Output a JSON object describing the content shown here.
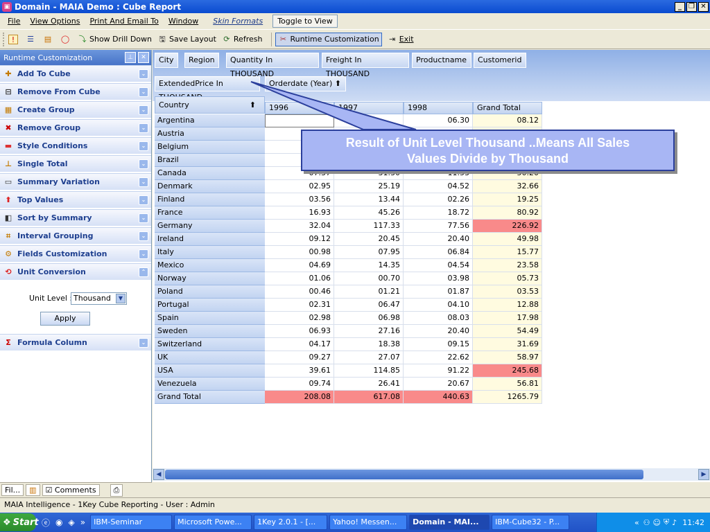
{
  "window": {
    "title": "Domain - MAIA Demo : Cube Report",
    "app_icon": "cube-icon",
    "min_glyph": "_",
    "max_glyph": "❐",
    "close_glyph": "✕"
  },
  "menu": {
    "file": "File",
    "view_options": "View Options",
    "print_email": "Print And Email To",
    "window": "Window",
    "skin_formats": "Skin Formats",
    "toggle_view": "Toggle to View"
  },
  "toolbar": {
    "show_drill_down": "Show Drill Down",
    "save_layout": "Save Layout",
    "refresh": "Refresh",
    "runtime_customization": "Runtime Customization",
    "exit": "Exit"
  },
  "panel": {
    "title": "Runtime Customization",
    "items": [
      "Add To Cube",
      "Remove From Cube",
      "Create Group",
      "Remove Group",
      "Style Conditions",
      "Single Total",
      "Summary Variation",
      "Top Values",
      "Sort by Summary",
      "Interval Grouping",
      "Fields Customization",
      "Unit Conversion"
    ],
    "unit_label": "Unit Level :",
    "unit_value": "Thousand",
    "apply": "Apply",
    "formula_column": "Formula Column",
    "bottom_tabs": [
      "Fil...",
      "Comments"
    ]
  },
  "fields": {
    "chips": [
      "City",
      "Region",
      "Quantity In THOUSAND",
      "Freight In THOUSAND",
      "Productname",
      "Customerid"
    ],
    "data_field": "ExtendedPrice In THOUSAND",
    "column_field": "Orderdate (Year)",
    "row_field": "Country"
  },
  "table": {
    "columns": [
      "1996",
      "1997",
      "1998",
      "Grand Total"
    ],
    "rows": [
      {
        "country": "Argentina",
        "v": [
          "",
          "",
          "06.30",
          "08.12"
        ]
      },
      {
        "country": "Austria",
        "v": [
          "",
          "",
          "",
          ""
        ]
      },
      {
        "country": "Belgium",
        "v": [
          "",
          "",
          "",
          ""
        ]
      },
      {
        "country": "Brazil",
        "v": [
          "",
          "",
          "",
          ""
        ]
      },
      {
        "country": "Canada",
        "v": [
          "07.37",
          "31.30",
          "11.53",
          "50.20"
        ]
      },
      {
        "country": "Denmark",
        "v": [
          "02.95",
          "25.19",
          "04.52",
          "32.66"
        ]
      },
      {
        "country": "Finland",
        "v": [
          "03.56",
          "13.44",
          "02.26",
          "19.25"
        ]
      },
      {
        "country": "France",
        "v": [
          "16.93",
          "45.26",
          "18.72",
          "80.92"
        ]
      },
      {
        "country": "Germany",
        "v": [
          "32.04",
          "117.33",
          "77.56",
          "226.92"
        ]
      },
      {
        "country": "Ireland",
        "v": [
          "09.12",
          "20.45",
          "20.40",
          "49.98"
        ]
      },
      {
        "country": "Italy",
        "v": [
          "00.98",
          "07.95",
          "06.84",
          "15.77"
        ]
      },
      {
        "country": "Mexico",
        "v": [
          "04.69",
          "14.35",
          "04.54",
          "23.58"
        ]
      },
      {
        "country": "Norway",
        "v": [
          "01.06",
          "00.70",
          "03.98",
          "05.73"
        ]
      },
      {
        "country": "Poland",
        "v": [
          "00.46",
          "01.21",
          "01.87",
          "03.53"
        ]
      },
      {
        "country": "Portugal",
        "v": [
          "02.31",
          "06.47",
          "04.10",
          "12.88"
        ]
      },
      {
        "country": "Spain",
        "v": [
          "02.98",
          "06.98",
          "08.03",
          "17.98"
        ]
      },
      {
        "country": "Sweden",
        "v": [
          "06.93",
          "27.16",
          "20.40",
          "54.49"
        ]
      },
      {
        "country": "Switzerland",
        "v": [
          "04.17",
          "18.38",
          "09.15",
          "31.69"
        ]
      },
      {
        "country": "UK",
        "v": [
          "09.27",
          "27.07",
          "22.62",
          "58.97"
        ]
      },
      {
        "country": "USA",
        "v": [
          "39.61",
          "114.85",
          "91.22",
          "245.68"
        ]
      },
      {
        "country": "Venezuela",
        "v": [
          "09.74",
          "26.41",
          "20.67",
          "56.81"
        ]
      }
    ],
    "grand_total_label": "Grand Total",
    "grand_totals": [
      "208.08",
      "617.08",
      "440.63",
      "1265.79"
    ],
    "highlight_color": "#f98a8a",
    "total_col_color": "#fffbe0"
  },
  "callout": {
    "line1": "Result of Unit Level Thousand ..Means All Sales",
    "line2": "Values Divide by Thousand"
  },
  "status": {
    "text": "MAIA Intelligence - 1Key Cube Reporting - User : Admin"
  },
  "taskbar": {
    "start": "Start",
    "tasks": [
      "IBM-Seminar",
      "Microsoft Powe...",
      "1Key 2.0.1 - [...",
      "Yahoo! Messen...",
      "Domain - MAI...",
      "IBM-Cube32 - P..."
    ],
    "clock": "11:42"
  }
}
